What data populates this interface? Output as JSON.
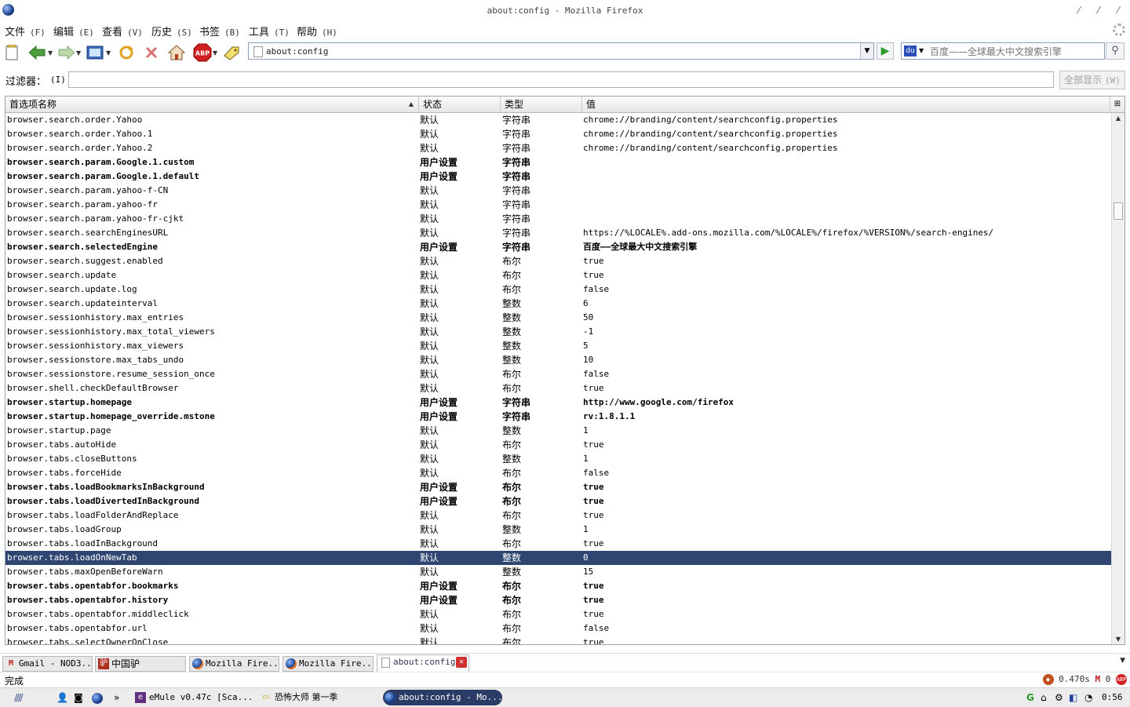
{
  "window": {
    "title": "about:config - Mozilla Firefox"
  },
  "menu": [
    {
      "label": "文件",
      "accel": "(F)"
    },
    {
      "label": "编辑",
      "accel": "(E)"
    },
    {
      "label": "查看",
      "accel": "(V)"
    },
    {
      "label": "历史",
      "accel": "(S)"
    },
    {
      "label": "书签",
      "accel": "(B)"
    },
    {
      "label": "工具",
      "accel": "(T)"
    },
    {
      "label": "帮助",
      "accel": "(H)"
    }
  ],
  "navbar": {
    "url": "about:config",
    "search_placeholder": "百度——全球最大中文搜索引擎",
    "icons": [
      "new-page-icon",
      "back-icon",
      "forward-icon",
      "screenshot-icon",
      "reload-icon",
      "stop-icon",
      "home-icon",
      "adblock-icon",
      "bookmark-tag-icon"
    ]
  },
  "filter": {
    "label": "过滤器：",
    "accel": "(I)",
    "value": "",
    "show_all": "全部显示",
    "show_all_accel": "(W)"
  },
  "columns": {
    "name": "首选项名称",
    "status": "状态",
    "type": "类型",
    "value": "值"
  },
  "rows": [
    {
      "name": "browser.search.order.Yahoo",
      "status": "默认",
      "type": "字符串",
      "value": "chrome://branding/content/searchconfig.properties",
      "user": false
    },
    {
      "name": "browser.search.order.Yahoo.1",
      "status": "默认",
      "type": "字符串",
      "value": "chrome://branding/content/searchconfig.properties",
      "user": false
    },
    {
      "name": "browser.search.order.Yahoo.2",
      "status": "默认",
      "type": "字符串",
      "value": "chrome://branding/content/searchconfig.properties",
      "user": false
    },
    {
      "name": "browser.search.param.Google.1.custom",
      "status": "用户设置",
      "type": "字符串",
      "value": "",
      "user": true
    },
    {
      "name": "browser.search.param.Google.1.default",
      "status": "用户设置",
      "type": "字符串",
      "value": "",
      "user": true
    },
    {
      "name": "browser.search.param.yahoo-f-CN",
      "status": "默认",
      "type": "字符串",
      "value": "",
      "user": false
    },
    {
      "name": "browser.search.param.yahoo-fr",
      "status": "默认",
      "type": "字符串",
      "value": "",
      "user": false
    },
    {
      "name": "browser.search.param.yahoo-fr-cjkt",
      "status": "默认",
      "type": "字符串",
      "value": "",
      "user": false
    },
    {
      "name": "browser.search.searchEnginesURL",
      "status": "默认",
      "type": "字符串",
      "value": "https://%LOCALE%.add-ons.mozilla.com/%LOCALE%/firefox/%VERSION%/search-engines/",
      "user": false
    },
    {
      "name": "browser.search.selectedEngine",
      "status": "用户设置",
      "type": "字符串",
      "value": "百度——全球最大中文搜索引擎",
      "user": true
    },
    {
      "name": "browser.search.suggest.enabled",
      "status": "默认",
      "type": "布尔",
      "value": "true",
      "user": false
    },
    {
      "name": "browser.search.update",
      "status": "默认",
      "type": "布尔",
      "value": "true",
      "user": false
    },
    {
      "name": "browser.search.update.log",
      "status": "默认",
      "type": "布尔",
      "value": "false",
      "user": false
    },
    {
      "name": "browser.search.updateinterval",
      "status": "默认",
      "type": "整数",
      "value": "6",
      "user": false
    },
    {
      "name": "browser.sessionhistory.max_entries",
      "status": "默认",
      "type": "整数",
      "value": "50",
      "user": false
    },
    {
      "name": "browser.sessionhistory.max_total_viewers",
      "status": "默认",
      "type": "整数",
      "value": "-1",
      "user": false
    },
    {
      "name": "browser.sessionhistory.max_viewers",
      "status": "默认",
      "type": "整数",
      "value": "5",
      "user": false
    },
    {
      "name": "browser.sessionstore.max_tabs_undo",
      "status": "默认",
      "type": "整数",
      "value": "10",
      "user": false
    },
    {
      "name": "browser.sessionstore.resume_session_once",
      "status": "默认",
      "type": "布尔",
      "value": "false",
      "user": false
    },
    {
      "name": "browser.shell.checkDefaultBrowser",
      "status": "默认",
      "type": "布尔",
      "value": "true",
      "user": false
    },
    {
      "name": "browser.startup.homepage",
      "status": "用户设置",
      "type": "字符串",
      "value": "http://www.google.com/firefox",
      "user": true
    },
    {
      "name": "browser.startup.homepage_override.mstone",
      "status": "用户设置",
      "type": "字符串",
      "value": "rv:1.8.1.1",
      "user": true
    },
    {
      "name": "browser.startup.page",
      "status": "默认",
      "type": "整数",
      "value": "1",
      "user": false
    },
    {
      "name": "browser.tabs.autoHide",
      "status": "默认",
      "type": "布尔",
      "value": "true",
      "user": false
    },
    {
      "name": "browser.tabs.closeButtons",
      "status": "默认",
      "type": "整数",
      "value": "1",
      "user": false
    },
    {
      "name": "browser.tabs.forceHide",
      "status": "默认",
      "type": "布尔",
      "value": "false",
      "user": false
    },
    {
      "name": "browser.tabs.loadBookmarksInBackground",
      "status": "用户设置",
      "type": "布尔",
      "value": "true",
      "user": true
    },
    {
      "name": "browser.tabs.loadDivertedInBackground",
      "status": "用户设置",
      "type": "布尔",
      "value": "true",
      "user": true
    },
    {
      "name": "browser.tabs.loadFolderAndReplace",
      "status": "默认",
      "type": "布尔",
      "value": "true",
      "user": false
    },
    {
      "name": "browser.tabs.loadGroup",
      "status": "默认",
      "type": "整数",
      "value": "1",
      "user": false
    },
    {
      "name": "browser.tabs.loadInBackground",
      "status": "默认",
      "type": "布尔",
      "value": "true",
      "user": false
    },
    {
      "name": "browser.tabs.loadOnNewTab",
      "status": "默认",
      "type": "整数",
      "value": "0",
      "user": false,
      "selected": true
    },
    {
      "name": "browser.tabs.maxOpenBeforeWarn",
      "status": "默认",
      "type": "整数",
      "value": "15",
      "user": false
    },
    {
      "name": "browser.tabs.opentabfor.bookmarks",
      "status": "用户设置",
      "type": "布尔",
      "value": "true",
      "user": true
    },
    {
      "name": "browser.tabs.opentabfor.history",
      "status": "用户设置",
      "type": "布尔",
      "value": "true",
      "user": true
    },
    {
      "name": "browser.tabs.opentabfor.middleclick",
      "status": "默认",
      "type": "布尔",
      "value": "true",
      "user": false
    },
    {
      "name": "browser.tabs.opentabfor.url",
      "status": "默认",
      "type": "布尔",
      "value": "false",
      "user": false
    },
    {
      "name": "browser.tabs.selectOwnerOnClose",
      "status": "默认",
      "type": "布尔",
      "value": "true",
      "user": false
    }
  ],
  "tabs": [
    {
      "label": "Gmail - NOD3...",
      "icon": "gmail-icon"
    },
    {
      "label": "中国驴",
      "icon": "site-icon"
    },
    {
      "label": "Mozilla Fire...",
      "icon": "firefox-icon"
    },
    {
      "label": "Mozilla Fire...",
      "icon": "firefox-icon"
    },
    {
      "label": "about:config",
      "icon": "page-icon",
      "active": true
    }
  ],
  "status": {
    "text": "完成",
    "timing": "0.470s",
    "mail_count": "0"
  },
  "taskbar": {
    "tasks": [
      {
        "label": "eMule v0.47c [Sca...",
        "icon": "emule-icon"
      },
      {
        "label": "恐怖大师 第一季",
        "icon": "folder-icon"
      },
      {
        "label": "about:config - Mo...",
        "icon": "firefox-icon",
        "active": true
      }
    ],
    "clock": "0:56"
  },
  "colors": {
    "selection": "#2f4672",
    "tab_close": "#d03030",
    "go_arrow": "#2a9a2a"
  }
}
